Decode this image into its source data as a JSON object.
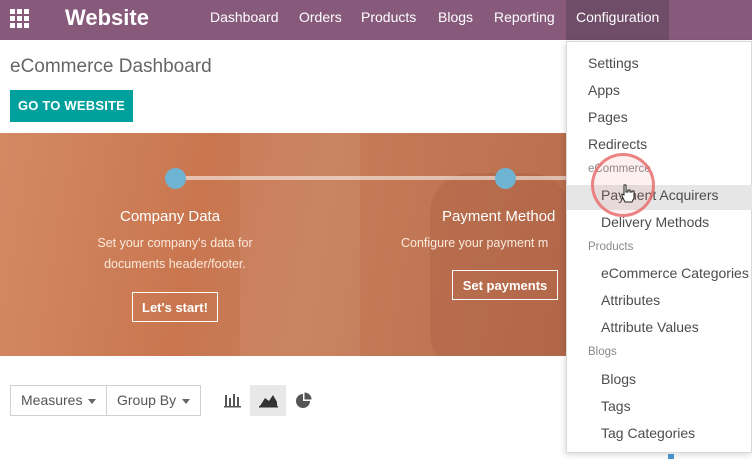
{
  "topbar": {
    "brand": "Website",
    "menu": [
      "Dashboard",
      "Orders",
      "Products",
      "Blogs",
      "Reporting",
      "Configuration"
    ],
    "active": "Configuration",
    "color": "#875a7b"
  },
  "page": {
    "title": "eCommerce Dashboard",
    "go_to_website": "GO TO WEBSITE"
  },
  "banner": {
    "steps": [
      {
        "title": "Company Data",
        "desc_line1": "Set your company's data for",
        "desc_line2": "documents header/footer.",
        "button": "Let's start!"
      },
      {
        "title": "Payment Method",
        "desc_line1": "Configure your payment m",
        "button": "Set payments"
      }
    ]
  },
  "controls": {
    "measures": "Measures",
    "group_by": "Group By",
    "views": [
      "bar-chart-icon",
      "area-chart-icon",
      "pie-chart-icon"
    ],
    "active_view": "area-chart-icon"
  },
  "dropdown": {
    "items_top": [
      "Settings",
      "Apps",
      "Pages",
      "Redirects"
    ],
    "section_ecommerce": "eCommerce",
    "ecommerce_items": [
      "Payment Acquirers",
      "Delivery Methods"
    ],
    "section_products": "Products",
    "product_items": [
      "eCommerce Categories",
      "Attributes",
      "Attribute Values"
    ],
    "section_blogs": "Blogs",
    "blog_items": [
      "Blogs",
      "Tags",
      "Tag Categories"
    ],
    "hovered": "Payment Acquirers"
  }
}
